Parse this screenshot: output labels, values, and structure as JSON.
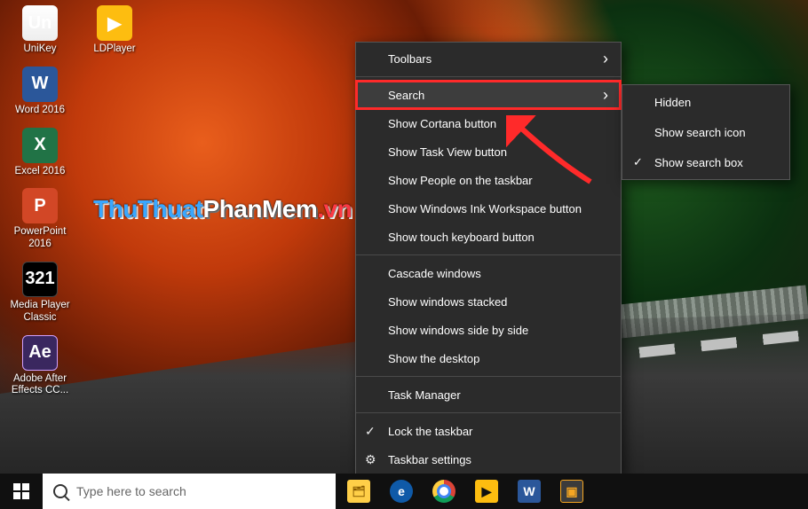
{
  "desktop_icons": [
    {
      "id": "unikey",
      "label": "UniKey",
      "glyph": "Un",
      "glyph_class": "g-unikey"
    },
    {
      "id": "ldplayer",
      "label": "LDPlayer",
      "glyph": "▶",
      "glyph_class": "g-ldplayer"
    },
    {
      "id": "word",
      "label": "Word 2016",
      "glyph": "W",
      "glyph_class": "g-word"
    },
    {
      "id": "excel",
      "label": "Excel 2016",
      "glyph": "X",
      "glyph_class": "g-excel"
    },
    {
      "id": "ppt",
      "label": "PowerPoint 2016",
      "glyph": "P",
      "glyph_class": "g-ppt"
    },
    {
      "id": "mpc",
      "label": "Media Player Classic",
      "glyph": "321",
      "glyph_class": "g-mpc"
    },
    {
      "id": "ae",
      "label": "Adobe After Effects CC...",
      "glyph": "Ae",
      "glyph_class": "g-ae"
    }
  ],
  "watermark": {
    "a": "ThuThuat",
    "b": "PhanMem",
    "c": ".vn"
  },
  "context_menu": {
    "items": [
      {
        "label": "Toolbars",
        "expand": true
      },
      {
        "sep": true
      },
      {
        "label": "Search",
        "expand": true,
        "highlight": true
      },
      {
        "label": "Show Cortana button"
      },
      {
        "label": "Show Task View button"
      },
      {
        "label": "Show People on the taskbar"
      },
      {
        "label": "Show Windows Ink Workspace button"
      },
      {
        "label": "Show touch keyboard button"
      },
      {
        "sep": true
      },
      {
        "label": "Cascade windows"
      },
      {
        "label": "Show windows stacked"
      },
      {
        "label": "Show windows side by side"
      },
      {
        "label": "Show the desktop"
      },
      {
        "sep": true
      },
      {
        "label": "Task Manager"
      },
      {
        "sep": true
      },
      {
        "label": "Lock the taskbar",
        "pre_icon": "✓"
      },
      {
        "label": "Taskbar settings",
        "pre_icon": "⚙"
      }
    ]
  },
  "submenu": {
    "items": [
      {
        "label": "Hidden"
      },
      {
        "label": "Show search icon"
      },
      {
        "label": "Show search box",
        "checked": true
      }
    ]
  },
  "taskbar": {
    "search_placeholder": "Type here to search",
    "pinned": [
      {
        "id": "explorer",
        "glyph": "🗂",
        "sq": "explorer"
      },
      {
        "id": "edge",
        "glyph": "e",
        "sq": "edge"
      },
      {
        "id": "chrome",
        "glyph": "",
        "sq": "chrome"
      },
      {
        "id": "ldplayer",
        "glyph": "▶",
        "sq": "ld"
      },
      {
        "id": "word",
        "glyph": "W",
        "sq": "word"
      },
      {
        "id": "vmware",
        "glyph": "▣",
        "sq": "vm"
      }
    ]
  },
  "annotation": {
    "arrow_color": "#ff2a2a"
  }
}
